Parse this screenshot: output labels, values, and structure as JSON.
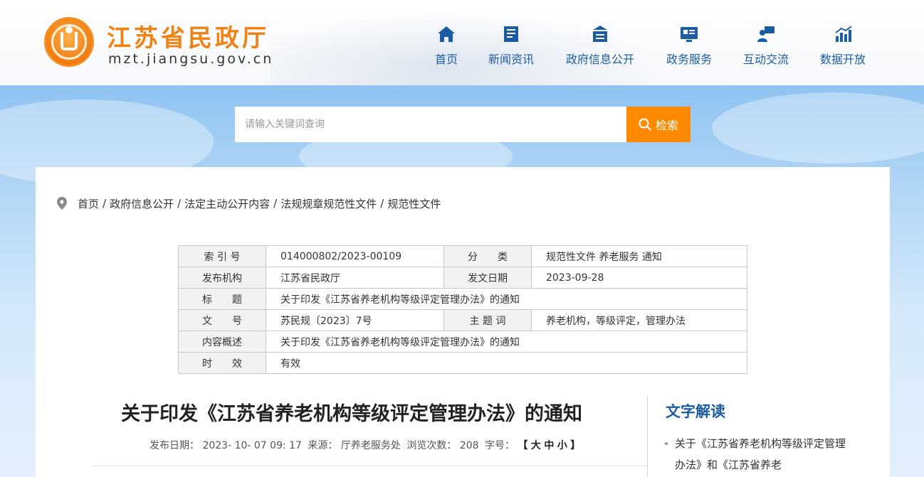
{
  "header": {
    "site_title": "江苏省民政厅",
    "site_domain": "mzt.jiangsu.gov.cn"
  },
  "nav": {
    "items": [
      {
        "label": "首页",
        "icon": "home-icon"
      },
      {
        "label": "新闻资讯",
        "icon": "news-icon"
      },
      {
        "label": "政府信息公开",
        "icon": "government-info-icon"
      },
      {
        "label": "政务服务",
        "icon": "service-icon"
      },
      {
        "label": "互动交流",
        "icon": "interaction-icon"
      },
      {
        "label": "数据开放",
        "icon": "data-chart-icon"
      }
    ]
  },
  "search": {
    "placeholder": "请输入关键词查询",
    "button_label": "检索"
  },
  "breadcrumb": {
    "items": [
      "首页",
      "政府信息公开",
      "法定主动公开内容",
      "法规规章规范性文件",
      "规范性文件"
    ],
    "separator": "/"
  },
  "meta_table": {
    "index_label": "索 引 号",
    "index_value": "014000802/2023-00109",
    "category_label": "分　　类",
    "category_value": "规范性文件 养老服务 通知",
    "publisher_label": "发布机构",
    "publisher_value": "江苏省民政厅",
    "issue_date_label": "发文日期",
    "issue_date_value": "2023-09-28",
    "title_label": "标　　题",
    "title_value": "关于印发《江苏省养老机构等级评定管理办法》的通知",
    "doc_no_label": "文　　号",
    "doc_no_value": "苏民规〔2023〕7号",
    "keywords_label": "主 题 词",
    "keywords_value": "养老机构，等级评定，管理办法",
    "summary_label": "内容概述",
    "summary_value": "关于印发《江苏省养老机构等级评定管理办法》的通知",
    "validity_label": "时　　效",
    "validity_value": "有效"
  },
  "article": {
    "title": "关于印发《江苏省养老机构等级评定管理办法》的通知",
    "publish_label": "发布日期：",
    "publish_value": "2023- 10- 07 09: 17",
    "source_label": "来源：",
    "source_value": "厅养老服务处",
    "views_label": "浏览次数：",
    "views_value": "208",
    "fontsize_label": "字号：",
    "bracket_open": "【",
    "size_large": "大",
    "size_medium": "中",
    "size_small": "小",
    "bracket_close": "】"
  },
  "sidebar": {
    "title": "文字解读",
    "items": [
      {
        "text": "关于《江苏省养老机构等级评定管理办法》和《江苏省养老"
      }
    ]
  },
  "colors": {
    "brand_orange": "#f08216",
    "nav_blue": "#1c5ca3",
    "search_button": "#ff8a00"
  }
}
